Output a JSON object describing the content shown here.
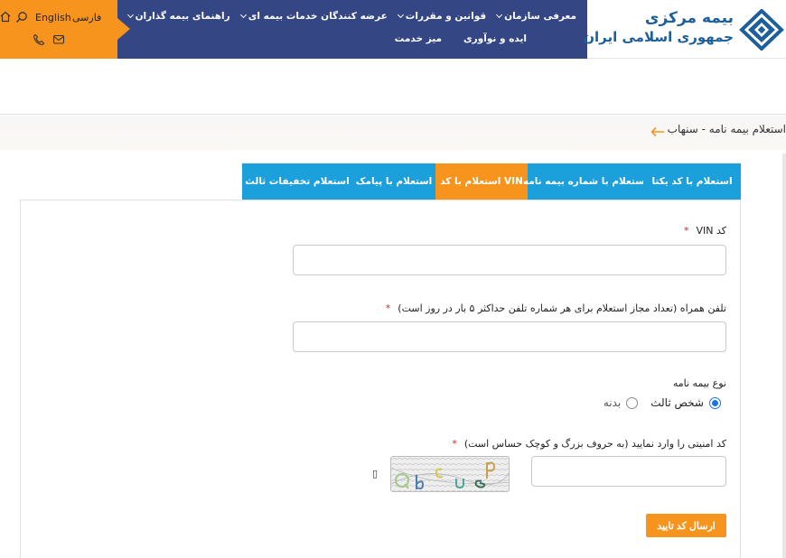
{
  "header": {
    "logo": {
      "line1": "بیمه مرکزی",
      "line2": "جمهوری اسلامی ایران"
    },
    "nav": {
      "row1": [
        {
          "label": "معرفی سازمان",
          "dropdown": true
        },
        {
          "label": "قوانین و مقررات",
          "dropdown": true
        },
        {
          "label": "عرضه کنندگان خدمات بیمه ای",
          "dropdown": true
        },
        {
          "label": "راهنمای بیمه گذاران",
          "dropdown": true
        }
      ],
      "row2": [
        {
          "label": "ایده و نوآوری"
        },
        {
          "label": "میز خدمت"
        }
      ]
    },
    "lang": {
      "fa": "فارسی",
      "en": "English"
    },
    "colors": {
      "nav": "#344683",
      "accent": "#f7941d",
      "tab": "#1ba0dc"
    }
  },
  "breadcrumb": {
    "text": "استعلام بیمه نامه - سنهاب"
  },
  "tabs": [
    {
      "label": "استعلام با کد یکتا",
      "active": false
    },
    {
      "label": "استعلام با شماره بیمه نامه",
      "active": false
    },
    {
      "label": "استعلام با کد VIN",
      "active": true
    },
    {
      "label": "استعلام با پیامک",
      "active": false
    },
    {
      "label": "استعلام تخفیفات ثالث",
      "active": false
    }
  ],
  "form": {
    "vin": {
      "label": "کد VIN",
      "value": ""
    },
    "phone": {
      "label": "تلفن همراه (تعداد مجاز استعلام برای هر شماره تلفن حداکثر ۵ بار در روز است)",
      "value": ""
    },
    "policy_type": {
      "label": "نوع بیمه نامه",
      "options": [
        {
          "label": "شخص ثالث",
          "selected": true
        },
        {
          "label": "بدنه",
          "selected": false
        }
      ]
    },
    "captcha": {
      "label": "کد امنیتی را وارد نمایید (به حروف بزرگ و کوچک حساس است)",
      "value": "",
      "refresh_glyph": "▯"
    },
    "required_mark": "*",
    "submit_label": "ارسال کد تایید"
  }
}
